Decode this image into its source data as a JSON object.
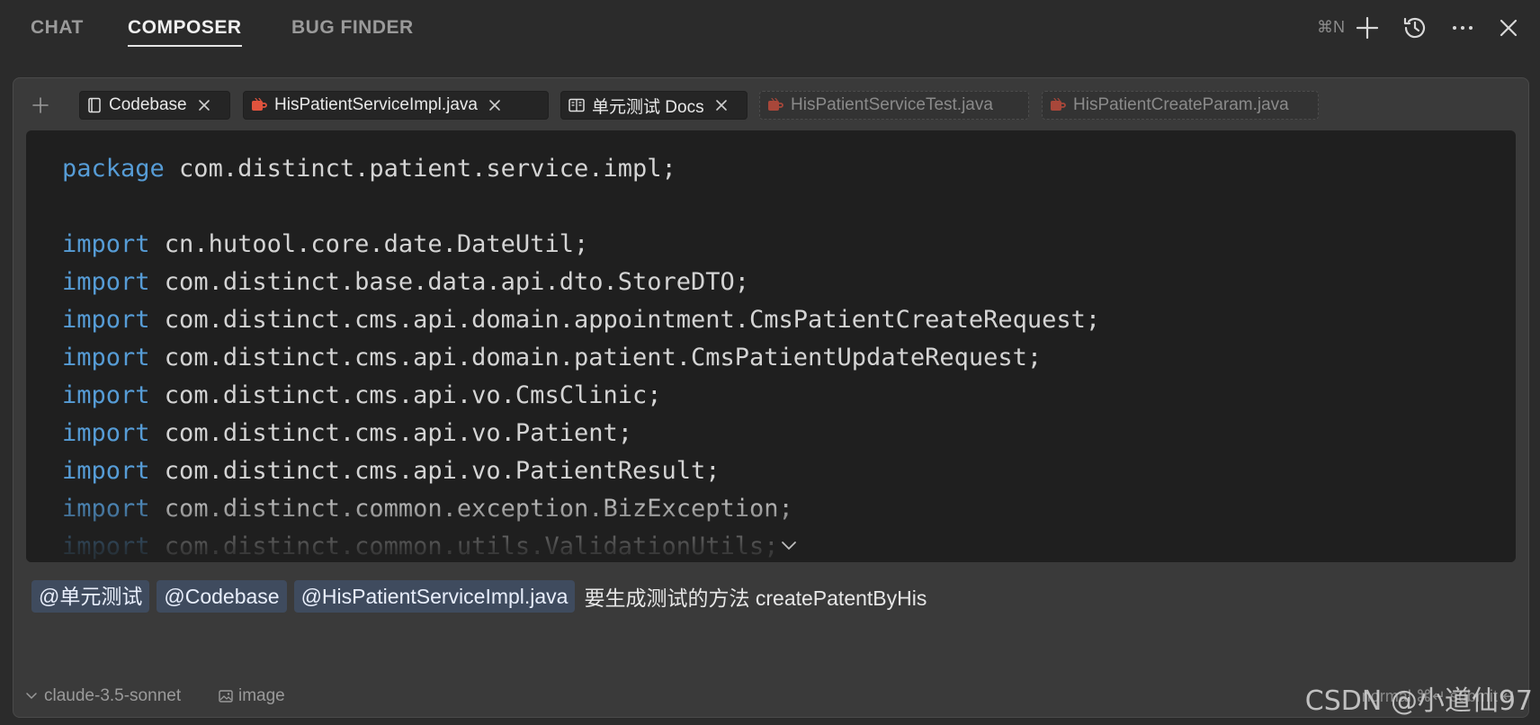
{
  "tabs": [
    {
      "label": "CHAT",
      "active": false
    },
    {
      "label": "COMPOSER",
      "active": true
    },
    {
      "label": "BUG FINDER",
      "active": false
    }
  ],
  "toolbar": {
    "new_shortcut": "⌘N",
    "icons": [
      "plus-icon",
      "history-icon",
      "more-icon",
      "close-icon"
    ]
  },
  "context_chips": [
    {
      "label": "Codebase",
      "icon": "book-icon",
      "pinned": true
    },
    {
      "label": "HisPatientServiceImpl.java",
      "icon": "java-icon",
      "pinned": true
    },
    {
      "label": "单元测试 Docs",
      "icon": "docs-icon",
      "pinned": true
    },
    {
      "label": "HisPatientServiceTest.java",
      "icon": "java-icon",
      "pinned": false
    },
    {
      "label": "HisPatientCreateParam.java",
      "icon": "java-icon",
      "pinned": false
    }
  ],
  "code": {
    "lines": [
      {
        "kw": "package",
        "rest": " com.distinct.patient.service.impl;"
      },
      {
        "kw": "",
        "rest": ""
      },
      {
        "kw": "import",
        "rest": " cn.hutool.core.date.DateUtil;"
      },
      {
        "kw": "import",
        "rest": " com.distinct.base.data.api.dto.StoreDTO;"
      },
      {
        "kw": "import",
        "rest": " com.distinct.cms.api.domain.appointment.CmsPatientCreateRequest;"
      },
      {
        "kw": "import",
        "rest": " com.distinct.cms.api.domain.patient.CmsPatientUpdateRequest;"
      },
      {
        "kw": "import",
        "rest": " com.distinct.cms.api.vo.CmsClinic;"
      },
      {
        "kw": "import",
        "rest": " com.distinct.cms.api.vo.Patient;"
      },
      {
        "kw": "import",
        "rest": " com.distinct.cms.api.vo.PatientResult;"
      },
      {
        "kw": "import",
        "rest": " com.distinct.common.exception.BizException;"
      },
      {
        "kw": "import",
        "rest": " com.distinct.common.utils.ValidationUtils;"
      }
    ]
  },
  "prompt": {
    "mentions": [
      "@单元测试",
      "@Codebase",
      "@HisPatientServiceImpl.java"
    ],
    "text": "要生成测试的方法 createPatentByHis"
  },
  "bottom": {
    "model": "claude-3.5-sonnet",
    "image_label": "image",
    "right_hint": "normal ⌘↵  submit ↵"
  },
  "watermark": "CSDN @小道仙97",
  "colors": {
    "background": "#2b2b2b",
    "code_background": "#1f1f1f",
    "keyword": "#569cd6",
    "mention_bg": "#3f4b5e",
    "java_icon": "#e0533d"
  }
}
